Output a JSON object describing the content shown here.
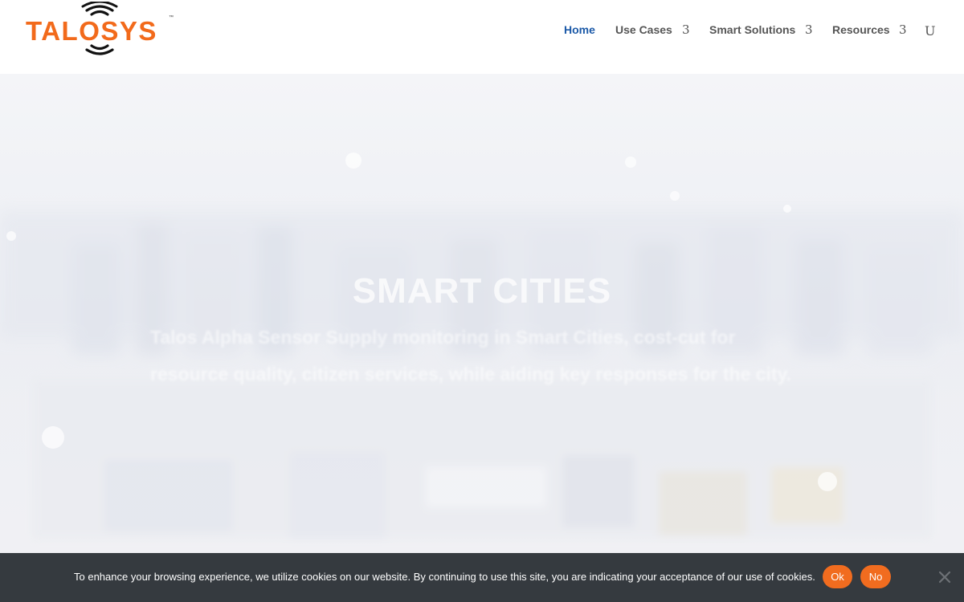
{
  "brand": {
    "logo_text": "TALOSYS",
    "trademark": "™",
    "accent_color": "#f26a1b"
  },
  "nav": {
    "items": [
      {
        "label": "Home",
        "active": true
      },
      {
        "label": "Use Cases",
        "arrow": "3"
      },
      {
        "label": "Smart Solutions",
        "arrow": "3"
      },
      {
        "label": "Resources",
        "arrow": "3"
      }
    ],
    "search_glyph": "U",
    "active_color": "#1c5aa8"
  },
  "hero": {
    "title": "SMART CITIES",
    "text": "Talos Alpha Sensor Supply monitoring in Smart Cities, cost-cut for resource quality, citizen services, while aiding key responses for the city."
  },
  "cookie": {
    "message": "To enhance your browsing experience, we utilize cookies on our website. By continuing to use this site, you are indicating your acceptance of our use of cookies.",
    "ok_label": "Ok",
    "no_label": "No",
    "close_icon": "close-icon"
  }
}
